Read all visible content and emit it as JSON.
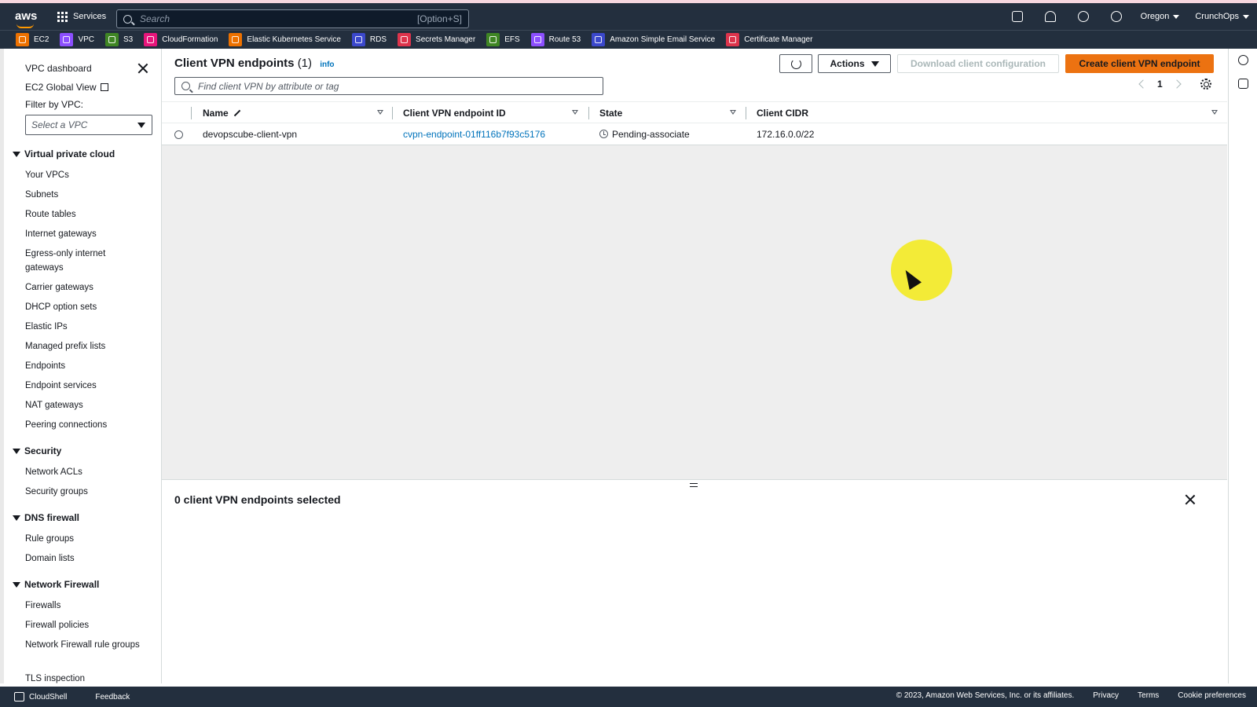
{
  "topbar": {
    "logo": "aws",
    "services_label": "Services",
    "search_placeholder": "Search",
    "search_shortcut": "[Option+S]",
    "region": "Oregon",
    "account": "CrunchOps"
  },
  "favorites": [
    {
      "label": "EC2",
      "color": "#ed7100"
    },
    {
      "label": "VPC",
      "color": "#8c4fff"
    },
    {
      "label": "S3",
      "color": "#3f8624"
    },
    {
      "label": "CloudFormation",
      "color": "#e7157b"
    },
    {
      "label": "Elastic Kubernetes Service",
      "color": "#ed7100"
    },
    {
      "label": "RDS",
      "color": "#3b48cc"
    },
    {
      "label": "Secrets Manager",
      "color": "#dd344c"
    },
    {
      "label": "EFS",
      "color": "#3f8624"
    },
    {
      "label": "Route 53",
      "color": "#8c4fff"
    },
    {
      "label": "Amazon Simple Email Service",
      "color": "#3b48cc"
    },
    {
      "label": "Certificate Manager",
      "color": "#dd344c"
    }
  ],
  "sidebar": {
    "dashboard": "VPC dashboard",
    "global_view": "EC2 Global View",
    "filter_label": "Filter by VPC:",
    "filter_placeholder": "Select a VPC",
    "sections": [
      {
        "title": "Virtual private cloud",
        "items": [
          "Your VPCs",
          "Subnets",
          "Route tables",
          "Internet gateways",
          "Egress-only internet gateways",
          "Carrier gateways",
          "DHCP option sets",
          "Elastic IPs",
          "Managed prefix lists",
          "Endpoints",
          "Endpoint services",
          "NAT gateways",
          "Peering connections"
        ]
      },
      {
        "title": "Security",
        "items": [
          "Network ACLs",
          "Security groups"
        ]
      },
      {
        "title": "DNS firewall",
        "items": [
          "Rule groups",
          "Domain lists"
        ]
      },
      {
        "title": "Network Firewall",
        "items": [
          "Firewalls",
          "Firewall policies",
          "Network Firewall rule groups",
          "TLS inspection"
        ]
      }
    ]
  },
  "main": {
    "title": "Client VPN endpoints",
    "count": "(1)",
    "info": "info",
    "actions_label": "Actions",
    "download_label": "Download client configuration",
    "create_label": "Create client VPN endpoint",
    "filter_placeholder": "Find client VPN by attribute or tag",
    "page_number": "1",
    "columns": [
      "Name",
      "Client VPN endpoint ID",
      "State",
      "Client CIDR"
    ],
    "rows": [
      {
        "name": "devopscube-client-vpn",
        "endpoint_id": "cvpn-endpoint-01ff116b7f93c5176",
        "state": "Pending-associate",
        "cidr": "172.16.0.0/22"
      }
    ],
    "split_title": "0 client VPN endpoints selected"
  },
  "footer": {
    "cloudshell": "CloudShell",
    "feedback": "Feedback",
    "copyright": "© 2023, Amazon Web Services, Inc. or its affiliates.",
    "privacy": "Privacy",
    "terms": "Terms",
    "cookies": "Cookie preferences"
  }
}
